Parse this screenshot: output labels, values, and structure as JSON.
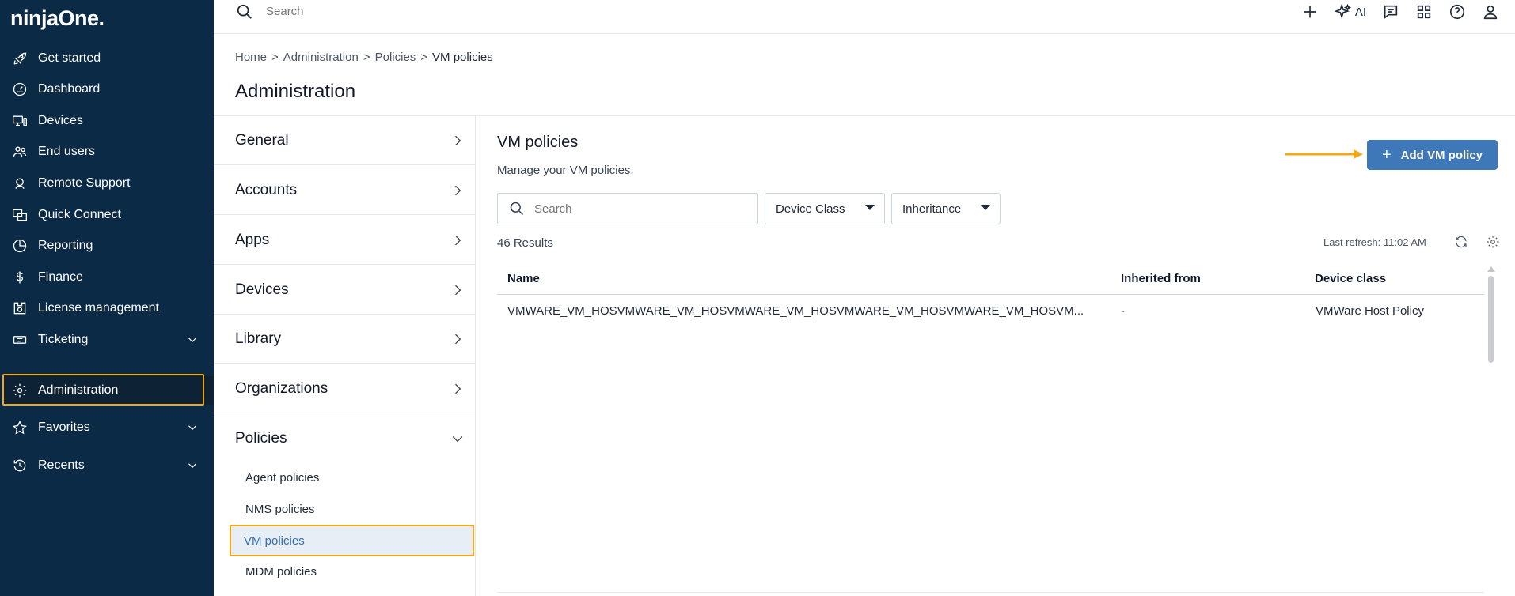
{
  "app": {
    "logo": "ninjaOne."
  },
  "nav": {
    "items": [
      {
        "label": "Get started",
        "icon": "rocket-icon"
      },
      {
        "label": "Dashboard",
        "icon": "gauge-icon"
      },
      {
        "label": "Devices",
        "icon": "devices-icon"
      },
      {
        "label": "End users",
        "icon": "users-icon"
      },
      {
        "label": "Remote Support",
        "icon": "headset-icon"
      },
      {
        "label": "Quick Connect",
        "icon": "quick-connect-icon"
      },
      {
        "label": "Reporting",
        "icon": "pie-chart-icon"
      },
      {
        "label": "Finance",
        "icon": "dollar-icon"
      },
      {
        "label": "License management",
        "icon": "license-icon"
      },
      {
        "label": "Ticketing",
        "icon": "ticket-icon"
      },
      {
        "label": "Administration",
        "icon": "gear-icon"
      },
      {
        "label": "Favorites",
        "icon": "star-icon"
      },
      {
        "label": "Recents",
        "icon": "history-icon"
      }
    ]
  },
  "topbar": {
    "search_placeholder": "Search",
    "ai_label": "AI"
  },
  "breadcrumb": [
    "Home",
    "Administration",
    "Policies",
    "VM policies"
  ],
  "page_title": "Administration",
  "submenu": {
    "items": [
      "General",
      "Accounts",
      "Apps",
      "Devices",
      "Library",
      "Organizations",
      "Policies"
    ],
    "policies_children": [
      "Agent policies",
      "NMS policies",
      "VM policies",
      "MDM policies"
    ]
  },
  "main": {
    "title": "VM policies",
    "subtitle": "Manage your VM policies.",
    "add_button": "Add VM policy",
    "search_placeholder": "Search",
    "filter_device_class": "Device Class",
    "filter_inheritance": "Inheritance",
    "results": "46 Results",
    "last_refresh": "Last refresh: 11:02 AM",
    "columns": [
      "Name",
      "Inherited from",
      "Device class"
    ],
    "rows": [
      {
        "name": "VMWARE_VM_HOSVMWARE_VM_HOSVMWARE_VM_HOSVMWARE_VM_HOSVMWARE_VM_HOSVM...",
        "inherited": "-",
        "device_class": "VMWare Host Policy"
      }
    ]
  },
  "colors": {
    "nav_bg": "#0b2a45",
    "accent": "#3f78b8",
    "highlight": "#f0a71a"
  }
}
